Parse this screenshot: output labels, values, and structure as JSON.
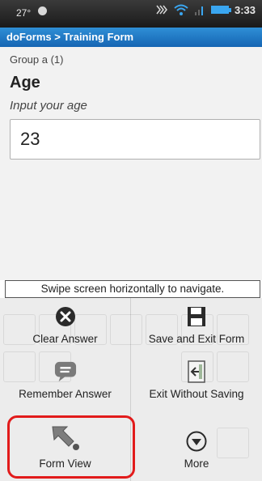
{
  "statusbar": {
    "temperature": "27°",
    "time": "3:33"
  },
  "titlebar": {
    "breadcrumb": "doForms > Training Form"
  },
  "form": {
    "group_label": "Group a (1)",
    "question": "Age",
    "hint": "Input your age",
    "answer_value": "23"
  },
  "navigation_hint": "Swipe screen horizontally to navigate.",
  "menu": {
    "items": [
      {
        "label": "Clear Answer",
        "icon": "clear-answer-icon"
      },
      {
        "label": "Save and Exit Form",
        "icon": "save-icon"
      },
      {
        "label": "Remember Answer",
        "icon": "chat-bubble-icon"
      },
      {
        "label": "Exit Without Saving",
        "icon": "exit-door-icon"
      },
      {
        "label": "Form View",
        "icon": "form-view-arrow-icon"
      },
      {
        "label": "More",
        "icon": "chevron-down-circle-icon"
      }
    ]
  },
  "colors": {
    "titlebar": "#1f7cc7",
    "highlight": "#e21b1b"
  }
}
